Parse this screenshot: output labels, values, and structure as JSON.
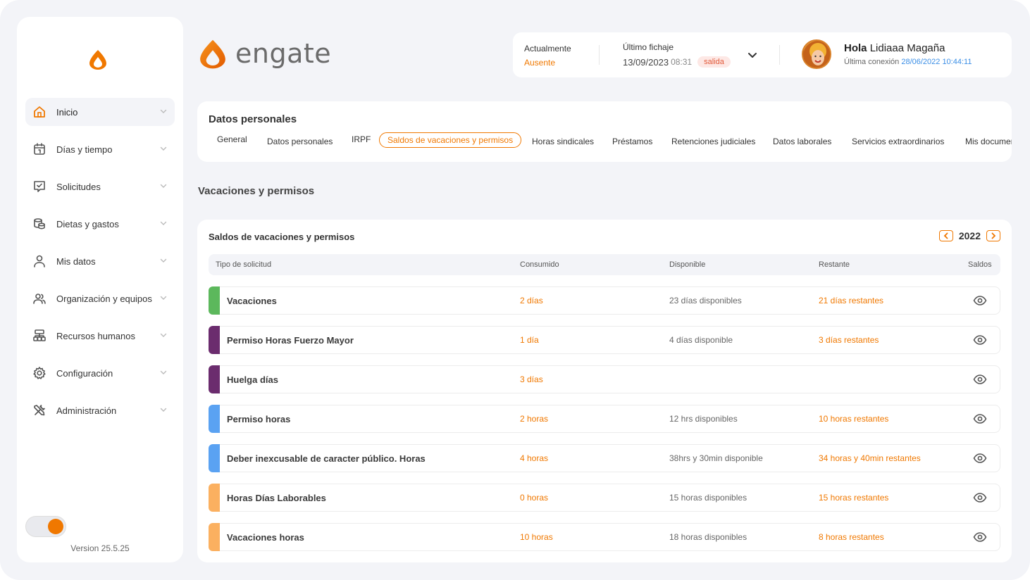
{
  "brand": {
    "name": "engate"
  },
  "sidebar": {
    "items": [
      {
        "label": "Inicio",
        "icon": "home-icon",
        "active": true
      },
      {
        "label": "Días y tiempo",
        "icon": "calendar-icon"
      },
      {
        "label": "Solicitudes",
        "icon": "request-check-icon"
      },
      {
        "label": "Dietas y gastos",
        "icon": "coins-icon"
      },
      {
        "label": "Mis datos",
        "icon": "user-icon"
      },
      {
        "label": "Organización y equipos",
        "icon": "users-icon"
      },
      {
        "label": "Recursos humanos",
        "icon": "org-chart-icon"
      },
      {
        "label": "Configuración",
        "icon": "gear-icon"
      },
      {
        "label": "Administración",
        "icon": "tools-icon"
      }
    ],
    "version": "Version 25.5.25"
  },
  "status": {
    "now_label": "Actualmente",
    "now_value": "Ausente",
    "fichaje_label": "Último fichaje",
    "fichaje_date": "13/09/2023",
    "fichaje_time": "08:31",
    "fichaje_badge": "salida"
  },
  "user": {
    "hello": "Hola",
    "name": "Lidiaaa Magaña",
    "last_label": "Última conexión",
    "last_value": "28/06/2022 10:44:11"
  },
  "tabs_card": {
    "title": "Datos personales",
    "tabs": [
      "General",
      "Datos personales",
      "IRPF",
      "Saldos de vacaciones y permisos",
      "Horas sindicales",
      "Préstamos",
      "Retenciones judiciales",
      "Datos laborales",
      "Servicios extraordinarios",
      "Mis documentos"
    ],
    "active_tab": "Saldos de vacaciones y permisos"
  },
  "section_title": "Vacaciones y permisos",
  "table": {
    "title": "Saldos de vacaciones y permisos",
    "year": "2022",
    "columns": [
      "Tipo de solicitud",
      "Consumido",
      "Disponible",
      "Restante",
      "Saldos"
    ],
    "rows": [
      {
        "name": "Vacaciones",
        "consumido": "2 días",
        "disponible": "23 días disponibles",
        "restante": "21 días restantes",
        "color": "#5cb85c"
      },
      {
        "name": "Permiso Horas Fuerzo Mayor",
        "consumido": "1 día",
        "disponible": "4 días disponible",
        "restante": "3 días restantes",
        "color": "#6b2c6e"
      },
      {
        "name": "Huelga días",
        "consumido": "3 días",
        "disponible": "",
        "restante": "",
        "color": "#6b2c6e"
      },
      {
        "name": "Permiso horas",
        "consumido": "2 horas",
        "disponible": "12 hrs disponibles",
        "restante": "10 horas restantes",
        "color": "#5aa2f2"
      },
      {
        "name": "Deber inexcusable de caracter público. Horas",
        "consumido": "4 horas",
        "disponible": "38hrs y 30min disponible",
        "restante": "34 horas y 40min restantes",
        "color": "#5aa2f2"
      },
      {
        "name": "Horas Días Laborables",
        "consumido": "0 horas",
        "disponible": "15 horas disponibles",
        "restante": "15 horas restantes",
        "color": "#fbb060"
      },
      {
        "name": "Vacaciones horas",
        "consumido": "10 horas",
        "disponible": "18 horas disponibles",
        "restante": "8 horas restantes",
        "color": "#fbb060"
      }
    ]
  },
  "colors": {
    "accent": "#f07800",
    "link": "#3a8ee6"
  }
}
